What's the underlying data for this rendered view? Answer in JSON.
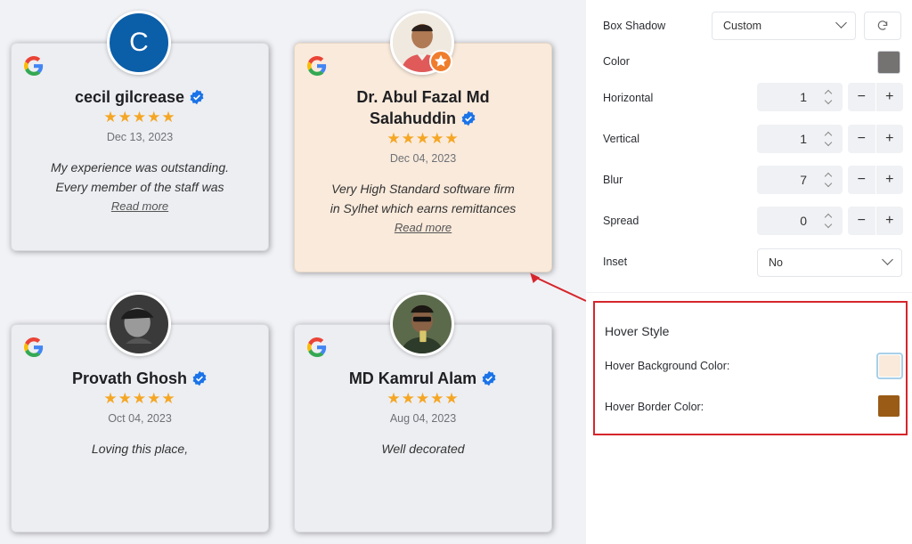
{
  "cards": [
    {
      "name": "cecil gilcrease",
      "date": "Dec 13, 2023",
      "text_lines": [
        "My experience was outstanding.",
        "Every member of the staff was"
      ],
      "read_more": "Read more",
      "rating": 5,
      "avatar_letter": "C",
      "avatar_color": "#0b5ea8"
    },
    {
      "name_lines": [
        "Dr. Abul Fazal Md",
        "Salahuddin"
      ],
      "date": "Dec 04, 2023",
      "text_lines": [
        "Very High Standard software firm",
        "in Sylhet which earns remittances"
      ],
      "read_more": "Read more",
      "rating": 5,
      "hover_background": "#f9eadb"
    },
    {
      "name": "Provath Ghosh",
      "date": "Oct 04, 2023",
      "text_lines": [
        "Loving this place,"
      ],
      "rating": 5
    },
    {
      "name": "MD Kamrul Alam",
      "date": "Aug 04, 2023",
      "text_lines": [
        "Well decorated"
      ],
      "rating": 5
    }
  ],
  "stars_glyph": "★★★★★",
  "settings": {
    "box_shadow_label": "Box Shadow",
    "box_shadow_value": "Custom",
    "color_label": "Color",
    "shadow_color": "#757272",
    "horizontal_label": "Horizontal",
    "horizontal_value": "1",
    "vertical_label": "Vertical",
    "vertical_value": "1",
    "blur_label": "Blur",
    "blur_value": "7",
    "spread_label": "Spread",
    "spread_value": "0",
    "inset_label": "Inset",
    "inset_value": "No",
    "minus": "−",
    "plus": "+"
  },
  "hover_style": {
    "title": "Hover Style",
    "bg_label": "Hover Background Color:",
    "bg_color": "#f9eadb",
    "border_label": "Hover Border Color:",
    "border_color": "#9a5b16"
  },
  "colors": {
    "accent_red": "#d6262b",
    "star": "#f5a623",
    "verified": "#1a73e8"
  }
}
